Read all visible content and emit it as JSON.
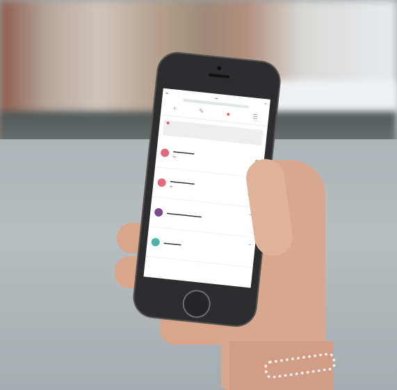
{
  "colors": {
    "alert_red": "#e05566",
    "teal_badge": "#5ec7d4",
    "purple_avatar": "#7b4a8c",
    "teal_avatar": "#4fb3a9",
    "green_dot": "#7fcfa4"
  },
  "phone": {
    "toolbar_icons": [
      "add-icon",
      "edit-icon",
      "alert-icon",
      "menu-icon"
    ],
    "list_items": [
      {
        "icon": "pin-icon",
        "avatar_color": "#e06a7a"
      },
      {
        "icon": "pin-icon",
        "avatar_color": "#e06a7a"
      },
      {
        "icon": "folder-icon",
        "avatar_color": "#7b4a8c"
      },
      {
        "icon": "check-icon",
        "avatar_color": "#4fb3a9"
      }
    ]
  }
}
